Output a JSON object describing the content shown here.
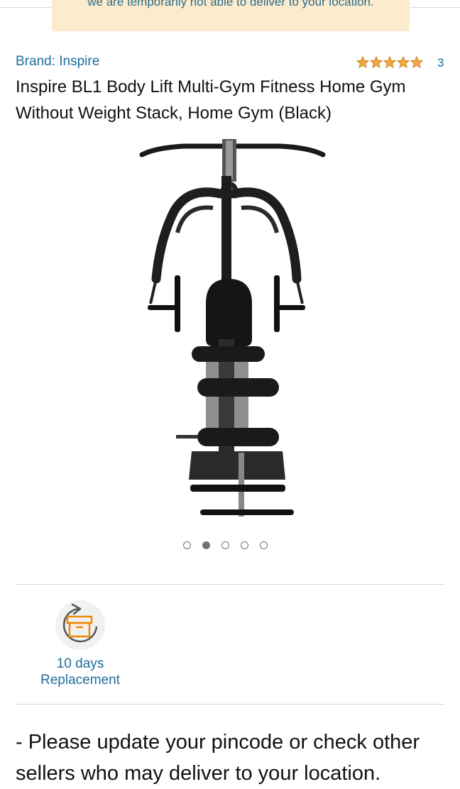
{
  "banner": {
    "text": "we are temporarily not able to deliver to your location."
  },
  "product": {
    "brand": "Brand: Inspire",
    "rating_stars": 5,
    "review_count": "3",
    "title": "Inspire BL1 Body Lift Multi-Gym Fitness Home Gym Without Weight Stack, Home Gym (Black)"
  },
  "carousel": {
    "total": 5,
    "active_index": 1
  },
  "features": {
    "replacement_line1": "10 days",
    "replacement_line2": "Replacement"
  },
  "note": {
    "text": "- Please update your pincode or check other sellers who may deliver to your location."
  },
  "colors": {
    "link": "#1c6e9c",
    "banner_bg": "#fcebcc",
    "star": "#f3a847",
    "icon_orange": "#f08804"
  }
}
